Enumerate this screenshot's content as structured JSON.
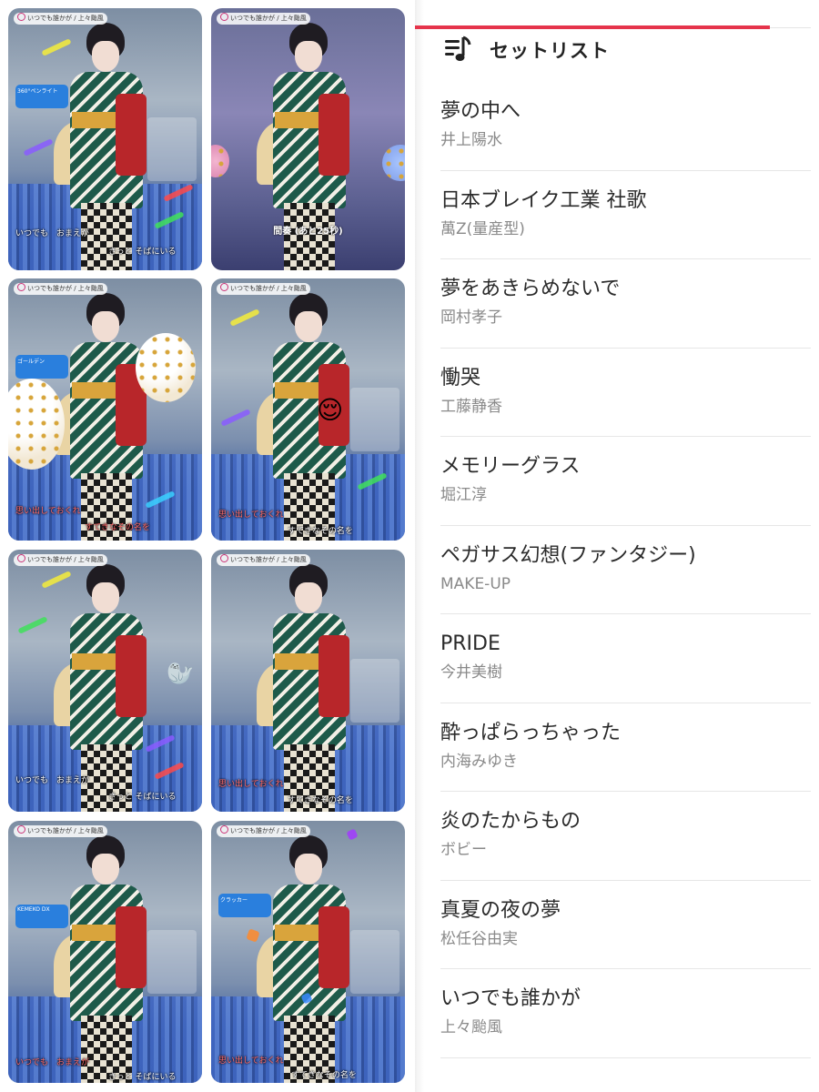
{
  "thumbnails": [
    {
      "chip": "いつでも誰かが / 上々颱風",
      "caption1": "いつでも　おまえが",
      "caption2": "きっと そばにいる",
      "notice": "360°ペンライト"
    },
    {
      "chip": "いつでも誰かが / 上々颱風",
      "interlude": "間奏 (あと25秒)"
    },
    {
      "chip": "いつでも誰かが / 上々颱風",
      "caption1": "思い出しておくれ",
      "caption2": "すてきなその名を",
      "notice": "ゴールデン"
    },
    {
      "chip": "いつでも誰かが / 上々颱風",
      "caption1": "思い出しておくれ",
      "caption2": "すてきなその名を"
    },
    {
      "chip": "いつでも誰かが / 上々颱風",
      "caption1": "いつでも　おまえが",
      "caption2": "きっと そばにいる"
    },
    {
      "chip": "いつでも誰かが / 上々颱風",
      "caption1": "思い出しておくれ",
      "caption2": "すてきなその名を"
    },
    {
      "chip": "いつでも誰かが / 上々颱風",
      "caption1": "いつでも　おまえが",
      "caption2": "きっと そばにいる",
      "notice": "KEMEKO DX"
    },
    {
      "chip": "いつでも誰かが / 上々颱風",
      "caption1": "思い出しておくれ",
      "caption2": "すてきなその名を",
      "notice": "クラッカー"
    }
  ],
  "setlist": {
    "title": "セットリスト",
    "songs": [
      {
        "title": "夢の中へ",
        "artist": "井上陽水"
      },
      {
        "title": "日本ブレイク工業 社歌",
        "artist": "萬Z(量産型)"
      },
      {
        "title": "夢をあきらめないで",
        "artist": "岡村孝子"
      },
      {
        "title": "慟哭",
        "artist": "工藤静香"
      },
      {
        "title": "メモリーグラス",
        "artist": "堀江淳"
      },
      {
        "title": "ペガサス幻想(ファンタジー)",
        "artist": "MAKE-UP"
      },
      {
        "title": "PRIDE",
        "artist": "今井美樹"
      },
      {
        "title": "酔っぱらっちゃった",
        "artist": "内海みゆき"
      },
      {
        "title": "炎のたからもの",
        "artist": "ボビー"
      },
      {
        "title": "真夏の夜の夢",
        "artist": "松任谷由実"
      },
      {
        "title": "いつでも誰かが",
        "artist": "上々颱風"
      }
    ]
  },
  "colors": {
    "accent": "#e5344b",
    "title_text": "#2a2a2a",
    "artist_text": "#8a8a8a",
    "divider": "#e6e6e6"
  }
}
